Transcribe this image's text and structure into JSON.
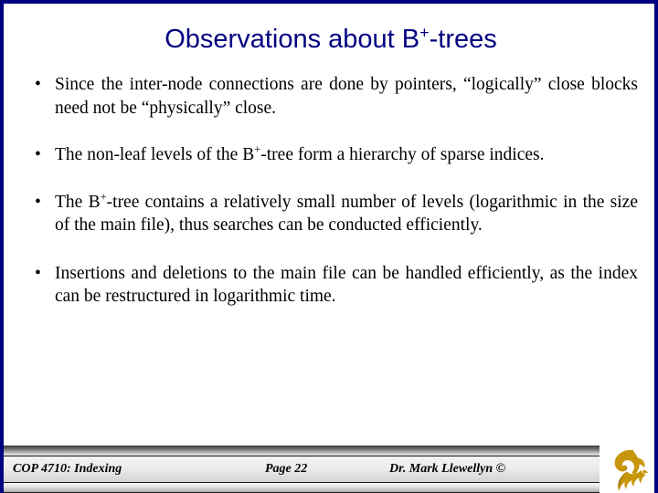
{
  "slide": {
    "title_prefix": "Observations about B",
    "title_sup": "+",
    "title_suffix": "-trees",
    "title_plain": "Observations about B+-trees",
    "background_color": "#ffffff",
    "border_color": "#000080",
    "title_color": "#000080",
    "body_color": "#000000"
  },
  "bullets": [
    {
      "marker": "•",
      "parts": [
        {
          "type": "text",
          "value": "Since the inter-node connections are done by pointers, “logically” close blocks need not be “physically” close."
        }
      ],
      "plain": "Since the inter-node connections are done by pointers, “logically” close blocks need not be “physically” close."
    },
    {
      "marker": "•",
      "parts": [
        {
          "type": "text",
          "value": "The non-leaf levels of the B"
        },
        {
          "type": "sup",
          "value": "+"
        },
        {
          "type": "text",
          "value": "-tree form a hierarchy of sparse indices."
        }
      ],
      "plain": "The non-leaf levels of the B+-tree form a hierarchy of sparse indices."
    },
    {
      "marker": "•",
      "parts": [
        {
          "type": "text",
          "value": "The B"
        },
        {
          "type": "sup",
          "value": "+"
        },
        {
          "type": "text",
          "value": "-tree contains a relatively small number of levels (logarithmic in the size of the main file), thus searches can be conducted efficiently."
        }
      ],
      "plain": "The B+-tree contains a relatively small number of levels (logarithmic in the size of the main file), thus searches can be conducted efficiently."
    },
    {
      "marker": "•",
      "parts": [
        {
          "type": "text",
          "value": "Insertions and deletions to the main file can be handled efficiently, as the index can be restructured in logarithmic time."
        }
      ],
      "plain": "Insertions and deletions to the main file can be handled efficiently, as the index can be restructured in logarithmic time."
    }
  ],
  "footer": {
    "course": "COP 4710: Indexing",
    "page": "Page 22",
    "author": "Dr. Mark Llewellyn ©",
    "logo_name": "ucf-pegasus-logo",
    "logo_color": "#c8960c",
    "logo_shadow_color": "#8a6708"
  }
}
